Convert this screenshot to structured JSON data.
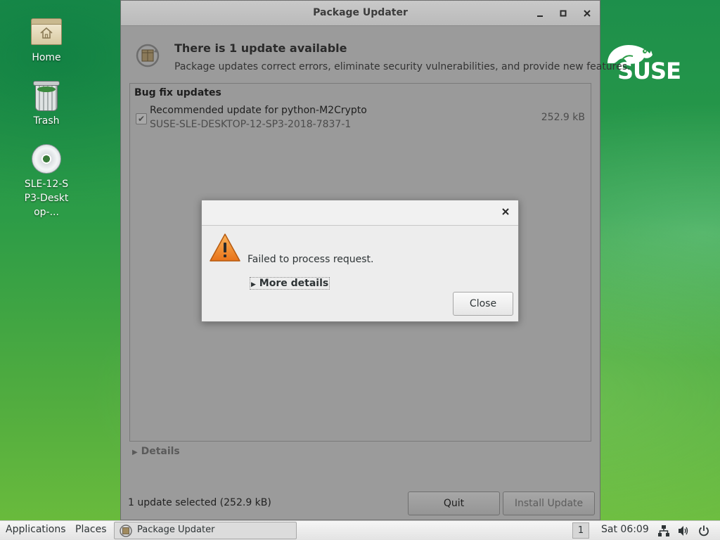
{
  "desktop": {
    "icons": [
      {
        "label": "Home"
      },
      {
        "label": "Trash"
      },
      {
        "label": "SLE-12-SP3-Desktop-..."
      }
    ],
    "logo": "SUSE"
  },
  "window": {
    "title": "Package Updater",
    "heading": "There is 1 update available",
    "subheading": "Package updates correct errors, eliminate security vulnerabilities, and provide new features.",
    "category": "Bug fix updates",
    "update": {
      "title": "Recommended update for python-M2Crypto",
      "id": "SUSE-SLE-DESKTOP-12-SP3-2018-7837-1",
      "size": "252.9 kB",
      "checked": true
    },
    "details_label": "Details",
    "status": "1 update selected (252.9 kB)",
    "quit_label": "Quit",
    "install_label": "Install Update"
  },
  "dialog": {
    "message": "Failed to process request.",
    "more_details": "More details",
    "close_label": "Close"
  },
  "taskbar": {
    "applications": "Applications",
    "places": "Places",
    "task_label": "Package Updater",
    "workspace": "1",
    "clock": "Sat 06:09"
  },
  "colors": {
    "desktop_green": "#2c9c47",
    "window_dimmed": "#9b9b9b",
    "dialog_bg": "#ededed",
    "warning_orange": "#f08a1e"
  }
}
